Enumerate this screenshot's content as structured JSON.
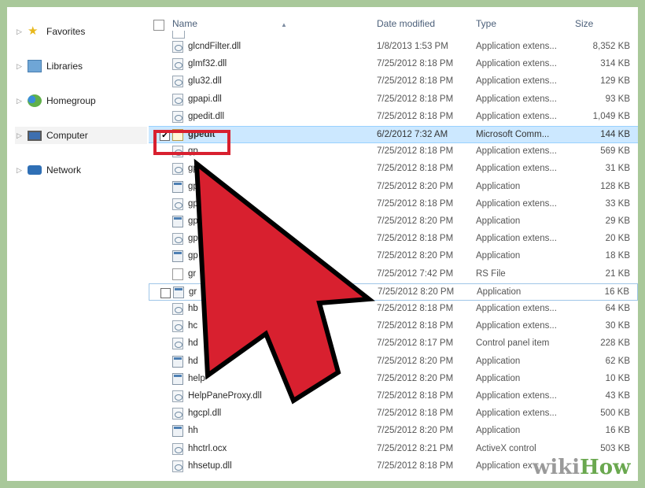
{
  "nav": {
    "items": [
      {
        "label": "Favorites",
        "icon": "star-icon"
      },
      {
        "label": "Libraries",
        "icon": "libraries-icon"
      },
      {
        "label": "Homegroup",
        "icon": "homegroup-icon"
      },
      {
        "label": "Computer",
        "icon": "computer-icon"
      },
      {
        "label": "Network",
        "icon": "network-icon"
      }
    ]
  },
  "columns": {
    "name": "Name",
    "date": "Date modified",
    "type": "Type",
    "size": "Size"
  },
  "rows": [
    {
      "name": "glcndFilter.dll",
      "date": "1/8/2013 1:53 PM",
      "type": "Application extens...",
      "size": "8,352 KB",
      "icon": "dll"
    },
    {
      "name": "glmf32.dll",
      "date": "7/25/2012 8:18 PM",
      "type": "Application extens...",
      "size": "314 KB",
      "icon": "dll"
    },
    {
      "name": "glu32.dll",
      "date": "7/25/2012 8:18 PM",
      "type": "Application extens...",
      "size": "129 KB",
      "icon": "dll"
    },
    {
      "name": "gpapi.dll",
      "date": "7/25/2012 8:18 PM",
      "type": "Application extens...",
      "size": "93 KB",
      "icon": "dll"
    },
    {
      "name": "gpedit.dll",
      "date": "7/25/2012 8:18 PM",
      "type": "Application extens...",
      "size": "1,049 KB",
      "icon": "dll"
    },
    {
      "name": "gpedit",
      "date": "6/2/2012 7:32 AM",
      "type": "Microsoft Comm...",
      "size": "144 KB",
      "icon": "msc",
      "selected": true
    },
    {
      "name": "gp",
      "date": "7/25/2012 8:18 PM",
      "type": "Application extens...",
      "size": "569 KB",
      "icon": "dll"
    },
    {
      "name": "gp",
      "date": "7/25/2012 8:18 PM",
      "type": "Application extens...",
      "size": "31 KB",
      "icon": "dll"
    },
    {
      "name": "gp",
      "date": "7/25/2012 8:20 PM",
      "type": "Application",
      "size": "128 KB",
      "icon": "app"
    },
    {
      "name": "gp",
      "date": "7/25/2012 8:18 PM",
      "type": "Application extens...",
      "size": "33 KB",
      "icon": "dll"
    },
    {
      "name": "gp",
      "date": "7/25/2012 8:20 PM",
      "type": "Application",
      "size": "29 KB",
      "icon": "app"
    },
    {
      "name": "gp",
      "date": "7/25/2012 8:18 PM",
      "type": "Application extens...",
      "size": "20 KB",
      "icon": "dll"
    },
    {
      "name": "gp",
      "date": "7/25/2012 8:20 PM",
      "type": "Application",
      "size": "18 KB",
      "icon": "app"
    },
    {
      "name": "gr",
      "date": "7/25/2012 7:42 PM",
      "type": "RS File",
      "size": "21 KB",
      "icon": "doc"
    },
    {
      "name": "gr",
      "date": "7/25/2012 8:20 PM",
      "type": "Application",
      "size": "16 KB",
      "icon": "app",
      "hover": true
    },
    {
      "name": "hb",
      "date": "7/25/2012 8:18 PM",
      "type": "Application extens...",
      "size": "64 KB",
      "icon": "dll"
    },
    {
      "name": "hc",
      "date": "7/25/2012 8:18 PM",
      "type": "Application extens...",
      "size": "30 KB",
      "icon": "dll"
    },
    {
      "name": "hd",
      "date": "7/25/2012 8:17 PM",
      "type": "Control panel item",
      "size": "228 KB",
      "icon": "dll"
    },
    {
      "name": "hd",
      "date": "7/25/2012 8:20 PM",
      "type": "Application",
      "size": "62 KB",
      "icon": "app"
    },
    {
      "name": "help",
      "date": "7/25/2012 8:20 PM",
      "type": "Application",
      "size": "10 KB",
      "icon": "app"
    },
    {
      "name": "HelpPaneProxy.dll",
      "date": "7/25/2012 8:18 PM",
      "type": "Application extens...",
      "size": "43 KB",
      "icon": "dll"
    },
    {
      "name": "hgcpl.dll",
      "date": "7/25/2012 8:18 PM",
      "type": "Application extens...",
      "size": "500 KB",
      "icon": "dll"
    },
    {
      "name": "hh",
      "date": "7/25/2012 8:20 PM",
      "type": "Application",
      "size": "16 KB",
      "icon": "app"
    },
    {
      "name": "hhctrl.ocx",
      "date": "7/25/2012 8:21 PM",
      "type": "ActiveX control",
      "size": "503 KB",
      "icon": "dll"
    },
    {
      "name": "hhsetup.dll",
      "date": "7/25/2012 8:18 PM",
      "type": "Application exte",
      "size": "",
      "icon": "dll"
    }
  ],
  "watermark": {
    "part1": "wiki",
    "part2": "How"
  },
  "colors": {
    "pointer": "#d8202f",
    "highlight": "#d8202f",
    "selection": "#cce8ff",
    "frame": "#a9c89a"
  }
}
